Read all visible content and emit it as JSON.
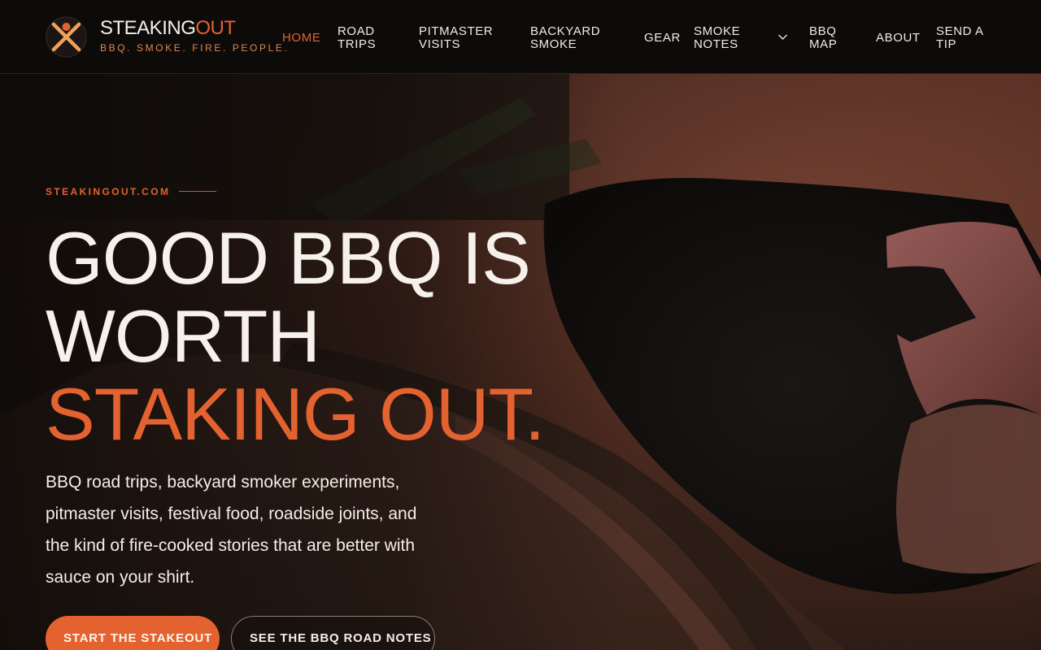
{
  "brand": {
    "name_main": "STEAKING",
    "name_accent": "OUT",
    "tagline": "BBQ. SMOKE. FIRE. PEOPLE.",
    "logo_icon": "flame-person-logo"
  },
  "nav": {
    "home": "HOME",
    "road_trips_1": "ROAD",
    "road_trips_2": "TRIPS",
    "pitmaster_1": "PITMASTER",
    "pitmaster_2": "VISITS",
    "backyard_1": "BACKYARD",
    "backyard_2": "SMOKE",
    "gear": "GEAR",
    "smoke_notes_1": "SMOKE",
    "smoke_notes_2": "NOTES",
    "bbq_map_1": "BBQ",
    "bbq_map_2": "MAP",
    "about": "ABOUT",
    "send_tip_1": "SEND A",
    "send_tip_2": "TIP",
    "dropdown_icon": "chevron-down-icon"
  },
  "hero": {
    "eyebrow": "STEAKINGOUT.COM",
    "headline_1": "GOOD BBQ IS",
    "headline_2": "WORTH",
    "headline_3": "STAKING OUT.",
    "copy": "BBQ road trips, backyard smoker experiments, pitmaster visits, festival food, roadside joints, and the kind of fire-cooked stories that are better with sauce on your shirt.",
    "cta_primary": "START THE STAKEOUT",
    "cta_secondary": "SEE THE BBQ ROAD NOTES"
  },
  "colors": {
    "accent": "#e4622f",
    "header_bg": "#0d0b0a",
    "text": "#f4eee7"
  }
}
